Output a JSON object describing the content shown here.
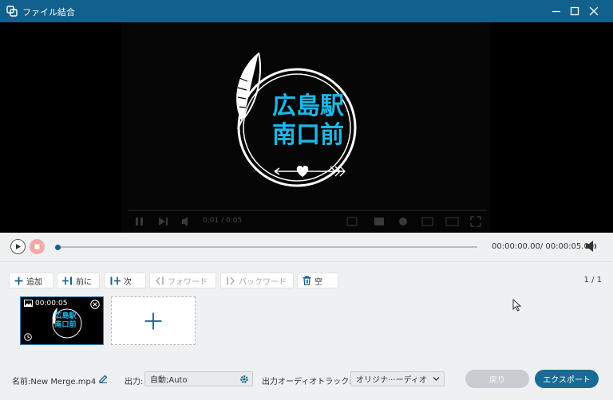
{
  "window": {
    "title": "ファイル結合",
    "icons": [
      "merge-app-icon",
      "minimize-icon",
      "maximize-icon",
      "close-icon"
    ]
  },
  "video": {
    "logo_line1": "広島駅",
    "logo_line2": "南口前",
    "embedded_controls": {
      "time_text": "0:01 / 0:05"
    },
    "colors": {
      "logo_text": "#1fb6e8"
    }
  },
  "player": {
    "timecode": "00:00:00.00/ 00:00:05.00",
    "progress": 0.0,
    "icons": [
      "play-icon",
      "stop-icon",
      "volume-icon"
    ]
  },
  "toolbar": {
    "add": "追加",
    "before": "前に",
    "after": "次",
    "forward": "フォワード",
    "backward": "バックワード",
    "clear": "空",
    "page": "1 / 1"
  },
  "clip": {
    "duration": "00:00:05",
    "line1": "広島駅",
    "line2": "南口前"
  },
  "bottom": {
    "name_label": "名前:",
    "name_value": "New Merge.mp4",
    "output_label": "出力:",
    "output_value": "自動;Auto",
    "audio_track_label": "出力オーディオトラック:",
    "audio_track_value": "オリジナ···ーディオ",
    "back_button": "戻り",
    "export_button": "エクスポート"
  },
  "colors": {
    "accent": "#11608e",
    "export": "#1a6a96",
    "stop": "#f3a9a9"
  }
}
